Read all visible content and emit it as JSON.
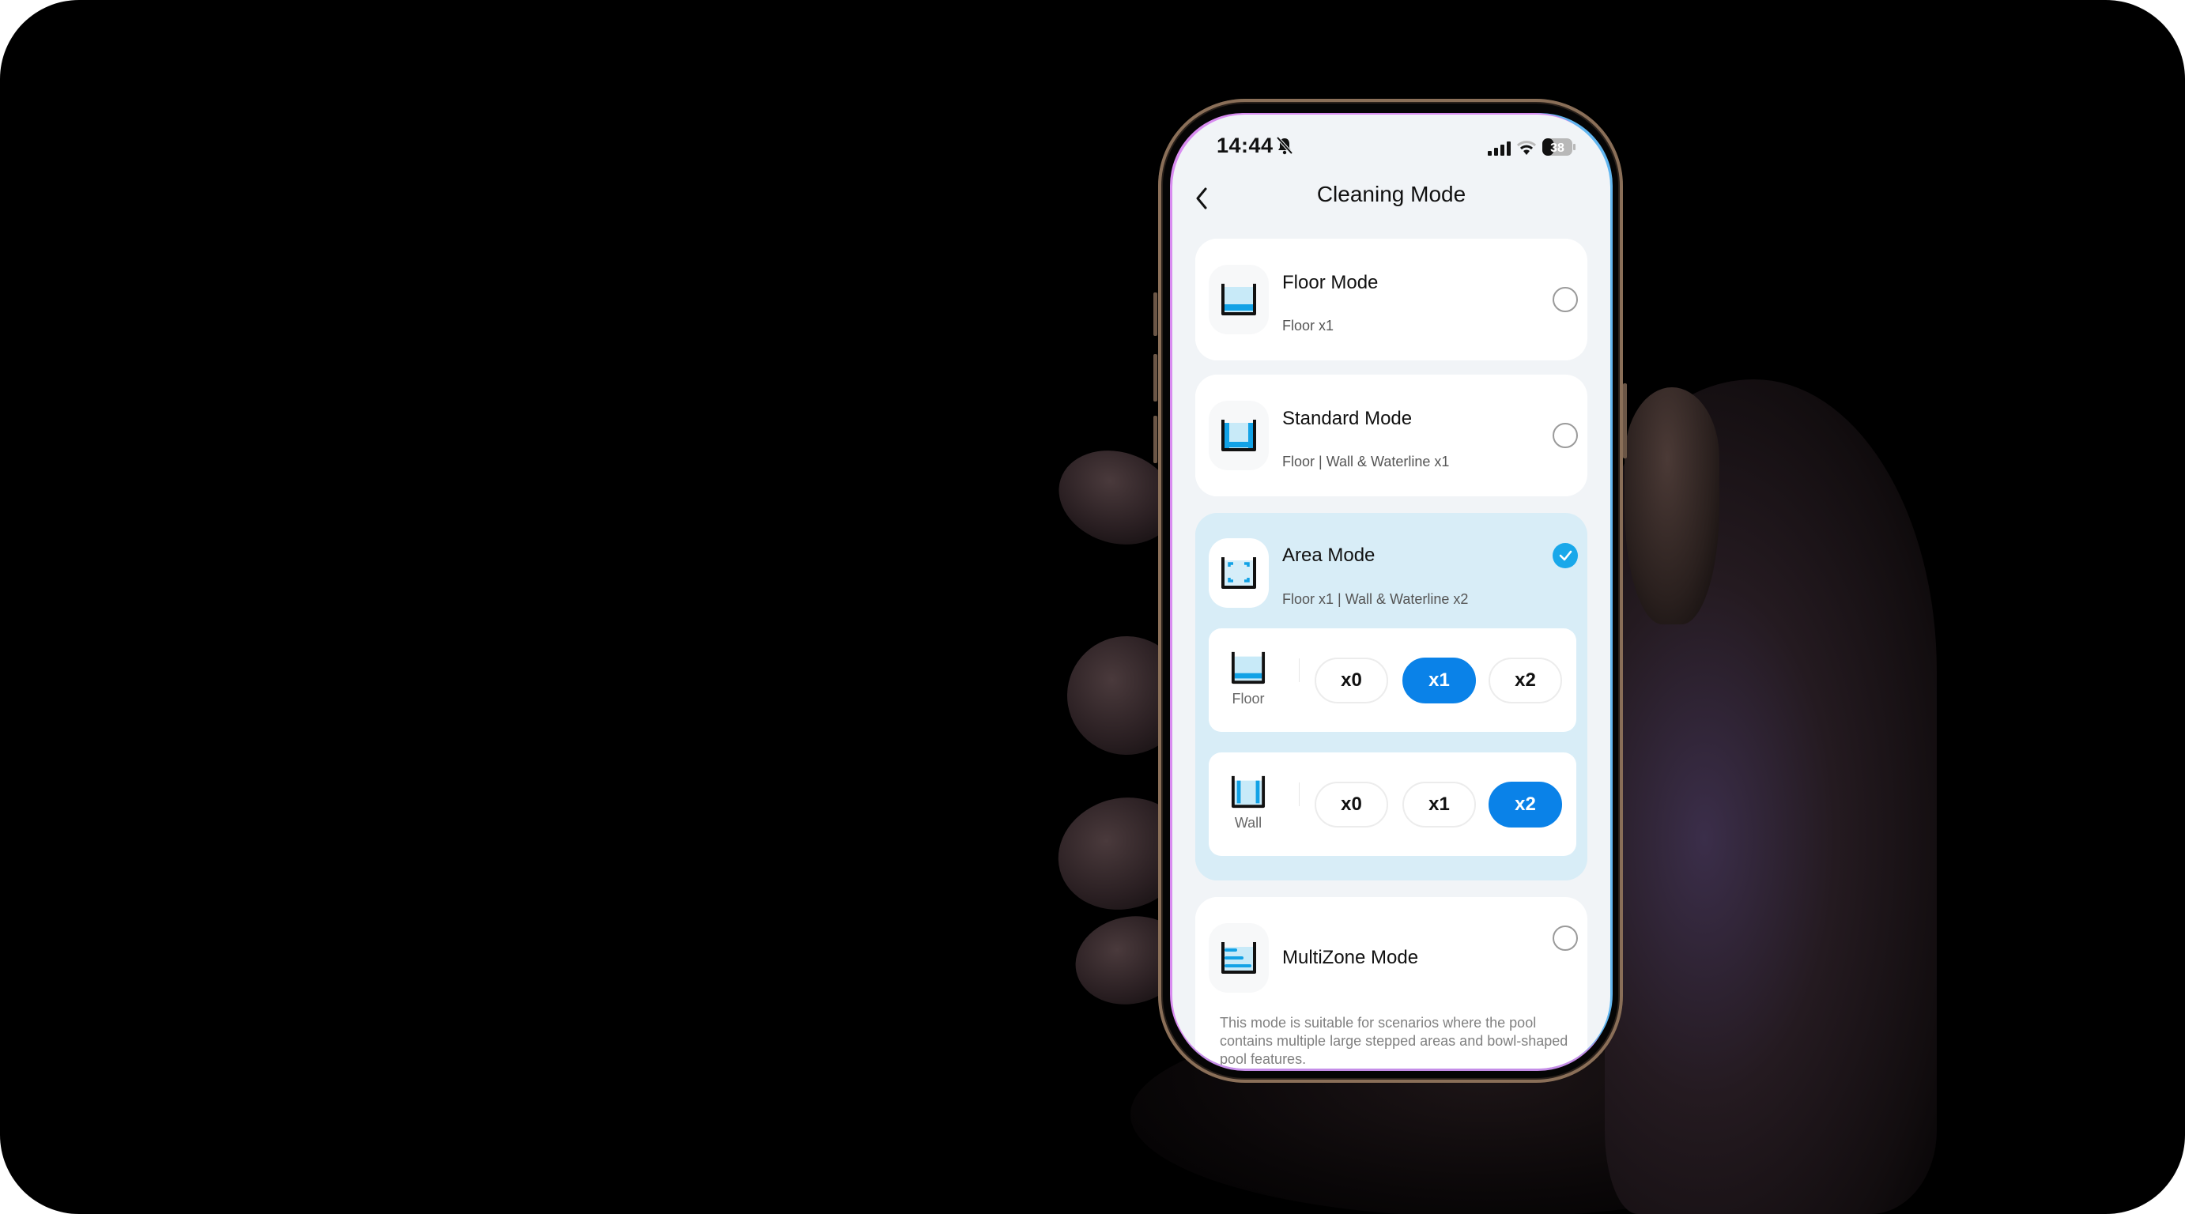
{
  "status_bar": {
    "time": "14:44",
    "silent_icon": "bell-slash-icon",
    "signal_icon": "cellular-signal-icon",
    "wifi_icon": "wifi-icon",
    "battery_percent": "38",
    "battery_level": 0.38
  },
  "header": {
    "back_icon": "chevron-left-icon",
    "title": "Cleaning Mode"
  },
  "modes": [
    {
      "title": "Floor Mode",
      "subtitle": "Floor x1",
      "icon": "pool-floor-icon",
      "selected": false
    },
    {
      "title": "Standard Mode",
      "subtitle": "Floor | Wall & Waterline x1",
      "icon": "pool-standard-icon",
      "selected": false
    },
    {
      "title": "Area Mode",
      "subtitle": "Floor x1 | Wall & Waterline x2",
      "icon": "pool-area-icon",
      "selected": true,
      "settings": [
        {
          "label": "Floor",
          "icon": "pool-floor-icon",
          "options": [
            "x0",
            "x1",
            "x2"
          ],
          "selected": "x1"
        },
        {
          "label": "Wall",
          "icon": "pool-wall-icon",
          "options": [
            "x0",
            "x1",
            "x2"
          ],
          "selected": "x2"
        }
      ]
    },
    {
      "title": "MultiZone Mode",
      "subtitle": "",
      "icon": "pool-multizone-icon",
      "selected": false,
      "description": "This mode is suitable for scenarios where the pool contains multiple large stepped areas and bowl-shaped pool features."
    }
  ],
  "colors": {
    "accent_blue": "#0a82e8",
    "check_blue": "#19a8ea",
    "selected_card_bg": "#d8edf7",
    "screen_bg": "#f1f4f7"
  }
}
